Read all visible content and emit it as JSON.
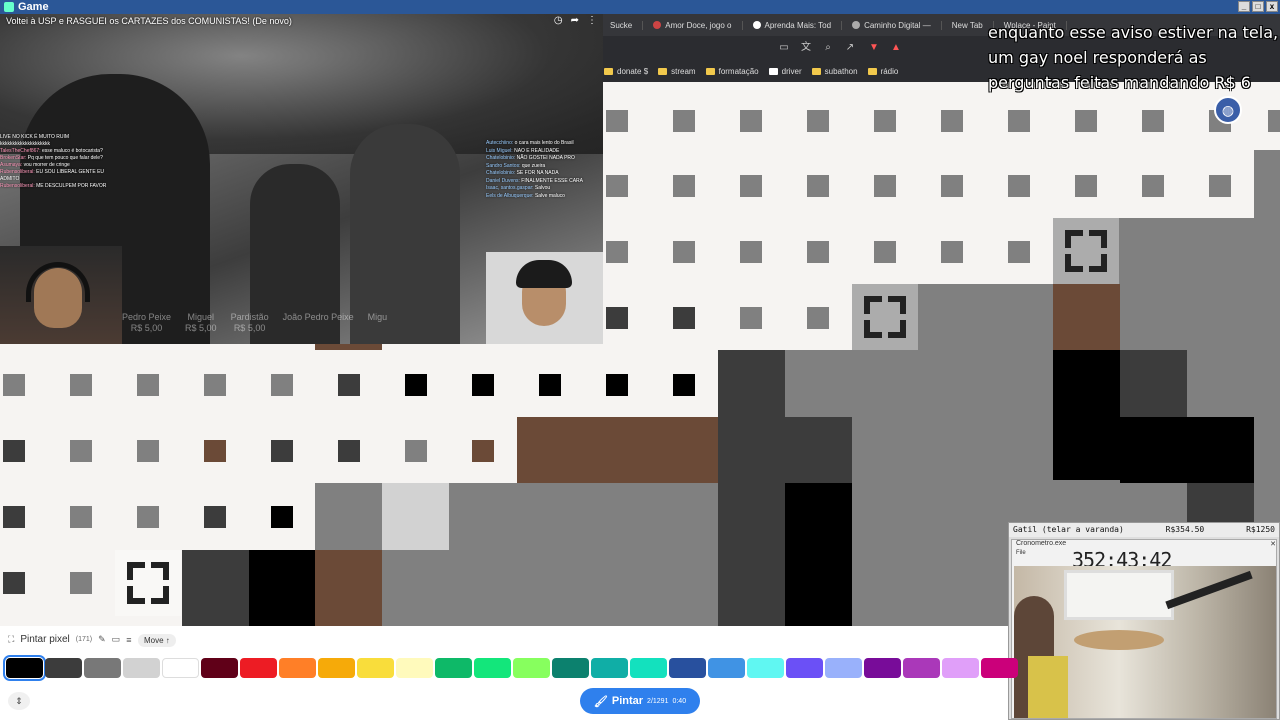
{
  "window": {
    "title": "Game"
  },
  "browser": {
    "tabs": [
      {
        "label": "Sucke"
      },
      {
        "label": "Amor Doce, jogo o"
      },
      {
        "label": "Aprenda Mais: Tod"
      },
      {
        "label": "Caminho Digital —"
      },
      {
        "label": "New Tab"
      },
      {
        "label": "Wplace - Paint"
      }
    ],
    "bookmarks": [
      "donate $",
      "stream",
      "formatação",
      "driver",
      "subathon",
      "rádio"
    ]
  },
  "stream": {
    "title": "Voltei à USP e RASGUEI os CARTAZES dos COMUNISTAS! (De novo)",
    "chat_left": [
      {
        "user": "",
        "text": "LIVE NO KICK É MUITO RUIM"
      },
      {
        "user": "",
        "text": "kkkkkkkkkkkkkkkkkkkk"
      },
      {
        "user": "TalesTheChef867:",
        "text": "esse maluco é botocarista?"
      },
      {
        "user": "BrokenStar:",
        "text": "Pq que tem pouco que falar dele?"
      },
      {
        "user": "Asumaya:",
        "text": "vou morrer de cringe"
      },
      {
        "user": "Rubensoliberal:",
        "text": "EU SOU LIBERAL GENTE EU ADMITO"
      },
      {
        "user": "Rubensoliberal:",
        "text": "ME DESCULPEM POR FAVOR"
      }
    ],
    "chat_right": [
      {
        "user": "Autecchiino:",
        "text": "o cara mais lento do Brasil"
      },
      {
        "user": "Luis Miguel:",
        "text": "NAO E REALIDADE"
      },
      {
        "user": "Chatelobinio:",
        "text": "NÃO GOSTEI NADA PRO"
      },
      {
        "user": "Sandro Santos:",
        "text": "que zueira"
      },
      {
        "user": "Chatelobinio:",
        "text": "SE FOR NA NADA"
      },
      {
        "user": "Daniel Duvens:",
        "text": "FINALMENTE ESSE CARA"
      },
      {
        "user": "Isaac, santos.gaspar:",
        "text": "Salvou"
      },
      {
        "user": "Eels de Albuquerque:",
        "text": "Salve maluco"
      }
    ],
    "donors": [
      {
        "name": "Pedro Peixe",
        "amount": "R$ 5,00"
      },
      {
        "name": "Miguel",
        "amount": "R$ 5,00"
      },
      {
        "name": "Pardistão",
        "amount": "R$ 5,00"
      },
      {
        "name": "João Pedro Peixe",
        "amount": ""
      },
      {
        "name": "Migu",
        "amount": ""
      }
    ]
  },
  "overlay": {
    "notice": "enquanto esse aviso estiver na tela, um gay noel responderá as perguntas feitas mandando R$ 6"
  },
  "camwin": {
    "label": "Gatil (telar a varanda)",
    "amount1": "R$354.50",
    "amount2": "R$1250",
    "app": "Cronometro.exe",
    "menu": "File",
    "timer": "352:43:42"
  },
  "palette": {
    "mode_label": "Pintar pixel",
    "count": "(171)",
    "move_label": "Move ↑",
    "pintar_label": "Pintar",
    "pintar_count": "2/1291",
    "pintar_timer": "0:40",
    "colors": [
      "#000000",
      "#3c3c3c",
      "#787878",
      "#d2d2d2",
      "#ffffff",
      "#600018",
      "#ed1c24",
      "#ff7f27",
      "#f6aa09",
      "#f9dd3b",
      "#fffabc",
      "#0eb968",
      "#13e67b",
      "#87ff5e",
      "#0c816e",
      "#10aea6",
      "#13e1be",
      "#28509e",
      "#4093e4",
      "#60f7f2",
      "#6b50f6",
      "#99b1fb",
      "#780c99",
      "#aa38b9",
      "#e09ff9",
      "#cb007a"
    ]
  }
}
